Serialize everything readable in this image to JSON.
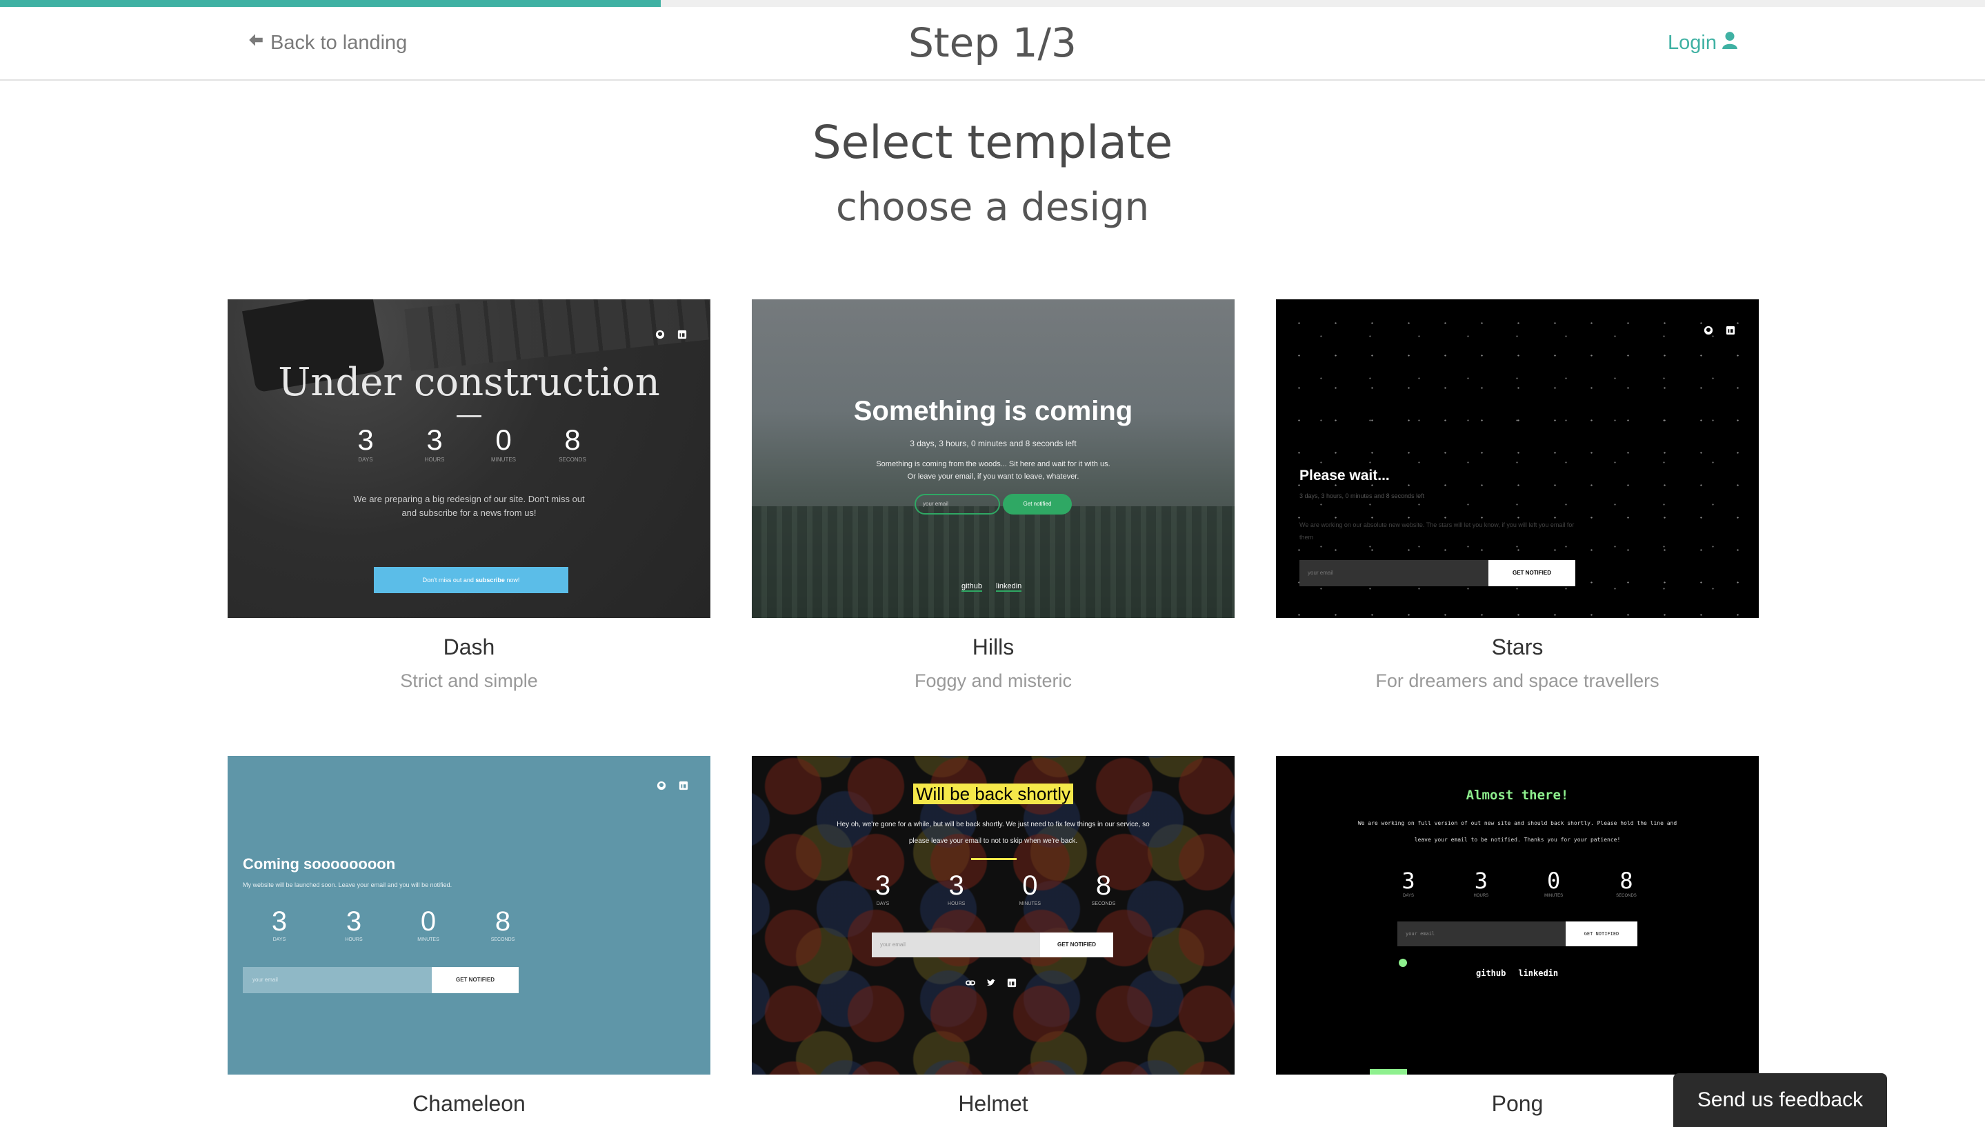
{
  "header": {
    "progress_fraction": 0.333,
    "back_label": "Back to landing",
    "step_title": "Step 1/3",
    "login_label": "Login"
  },
  "main": {
    "title": "Select template",
    "subtitle": "choose a design"
  },
  "templates": [
    {
      "name": "Dash",
      "description": "Strict and simple",
      "preview": {
        "heading": "Under construction",
        "countdown": [
          "3",
          "3",
          "0",
          "8"
        ],
        "units": [
          "DAYS",
          "HOURS",
          "MINUTES",
          "SECONDS"
        ],
        "text": "We are preparing a big redesign of our site. Don't miss out and subscribe for a news from us!",
        "button_pre": "Don't miss out and ",
        "button_bold": "subscribe",
        "button_post": " now!"
      }
    },
    {
      "name": "Hills",
      "description": "Foggy and misteric",
      "preview": {
        "heading": "Something is coming",
        "countdown_text": "3 days, 3 hours, 0 minutes and 8 seconds left",
        "text": "Something is coming from the woods... Sit here and wait for it with us. Or leave your email, if you want to leave, whatever.",
        "email_placeholder": "your email",
        "button": "Get notified",
        "links": [
          "github",
          "linkedin"
        ]
      }
    },
    {
      "name": "Stars",
      "description": "For dreamers and space travellers",
      "preview": {
        "heading": "Please wait...",
        "countdown_text": "3 days, 3 hours, 0 minutes and 8 seconds left",
        "text": "We are working on our absolute new website. The stars will let you know, if you will left you email for them",
        "email_placeholder": "your email",
        "button": "GET NOTIFIED"
      }
    },
    {
      "name": "Chameleon",
      "description": "",
      "preview": {
        "heading": "Coming soooooooon",
        "text": "My website will be launched soon. Leave your email and you will be notified.",
        "countdown": [
          "3",
          "3",
          "0",
          "8"
        ],
        "units": [
          "DAYS",
          "HOURS",
          "MINUTES",
          "SECONDS"
        ],
        "email_placeholder": "your email",
        "button": "GET NOTIFIED"
      }
    },
    {
      "name": "Helmet",
      "description": "",
      "preview": {
        "heading": "Will be back shortly",
        "text": "Hey oh, we're gone for a while, but will be back shortly. We just need to fix few things in our service, so please leave your email to not to skip when we're back.",
        "countdown": [
          "3",
          "3",
          "0",
          "8"
        ],
        "units": [
          "DAYS",
          "HOURS",
          "MINUTES",
          "SECONDS"
        ],
        "email_placeholder": "your email",
        "button": "GET NOTIFIED"
      }
    },
    {
      "name": "Pong",
      "description": "",
      "preview": {
        "heading": "Almost there!",
        "text": "We are working on full version of out new site and should back shortly. Please hold the line and leave your email to be notified. Thanks you for your patience!",
        "countdown": [
          "3",
          "3",
          "0",
          "8"
        ],
        "units": [
          "DAYS",
          "HOURS",
          "MINUTES",
          "SECONDS"
        ],
        "email_placeholder": "your email",
        "button": "GET NOTIFIED",
        "links": [
          "github",
          "linkedin"
        ]
      }
    }
  ],
  "feedback_label": "Send us feedback",
  "colors": {
    "accent": "#3fb1a3",
    "dash_button": "#5bbde8",
    "hills_button": "#2fa864",
    "chameleon_bg": "#5f96a8",
    "helmet_highlight": "#f5e84a",
    "pong_text": "#8ef08e"
  }
}
